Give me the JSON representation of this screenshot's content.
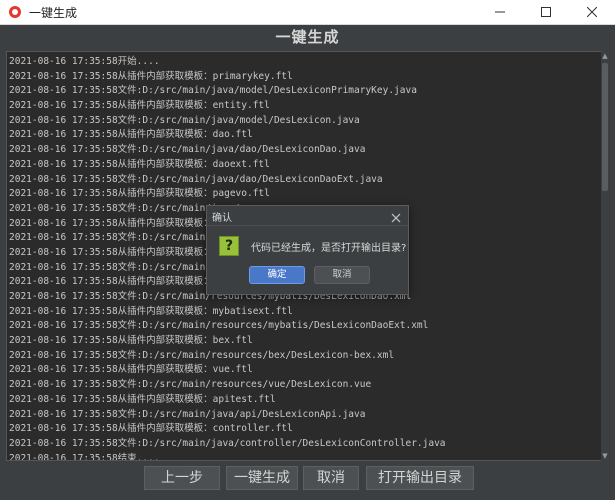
{
  "window": {
    "title": "一键生成",
    "icon": "app-logo-icon",
    "controls": [
      "minimize-icon",
      "maximize-icon",
      "close-icon"
    ]
  },
  "page": {
    "heading": "一键生成"
  },
  "log": {
    "lines": [
      "2021-08-16 17:35:58开始....",
      "2021-08-16 17:35:58从插件内部获取模板：primarykey.ftl",
      "2021-08-16 17:35:58文件:D:/src/main/java/model/DesLexiconPrimaryKey.java",
      "2021-08-16 17:35:58从插件内部获取模板：entity.ftl",
      "2021-08-16 17:35:58文件:D:/src/main/java/model/DesLexicon.java",
      "2021-08-16 17:35:58从插件内部获取模板：dao.ftl",
      "2021-08-16 17:35:58文件:D:/src/main/java/dao/DesLexiconDao.java",
      "2021-08-16 17:35:58从插件内部获取模板：daoext.ftl",
      "2021-08-16 17:35:58文件:D:/src/main/java/dao/DesLexiconDaoExt.java",
      "2021-08-16 17:35:58从插件内部获取模板：pagevo.ftl",
      "2021-08-16 17:35:58文件:D:/src/main/java/",
      "2021-08-16 17:35:58从插件内部获取模板：ser",
      "2021-08-16 17:35:58文件:D:/src/main/java/",
      "2021-08-16 17:35:58从插件内部获取模板：ser",
      "2021-08-16 17:35:58文件:D:/src/main/java/",
      "2021-08-16 17:35:58从插件内部获取模板：myb",
      "2021-08-16 17:35:58文件:D:/src/main/resources/mybatis/DesLexiconDao.xml",
      "2021-08-16 17:35:58从插件内部获取模板：mybatisext.ftl",
      "2021-08-16 17:35:58文件:D:/src/main/resources/mybatis/DesLexiconDaoExt.xml",
      "2021-08-16 17:35:58从插件内部获取模板：bex.ftl",
      "2021-08-16 17:35:58文件:D:/src/main/resources/bex/DesLexicon-bex.xml",
      "2021-08-16 17:35:58从插件内部获取模板：vue.ftl",
      "2021-08-16 17:35:58文件:D:/src/main/resources/vue/DesLexicon.vue",
      "2021-08-16 17:35:58从插件内部获取模板：apitest.ftl",
      "2021-08-16 17:35:58文件:D:/src/main/java/api/DesLexiconApi.java",
      "2021-08-16 17:35:58从插件内部获取模板：controller.ftl",
      "2021-08-16 17:35:58文件:D:/src/main/java/controller/DesLexiconController.java",
      "2021-08-16 17:35:58结束...."
    ]
  },
  "buttons": {
    "prev": "上一步",
    "generate": "一键生成",
    "cancel": "取消",
    "open_dir": "打开输出目录"
  },
  "dialog": {
    "title": "确认",
    "icon": "question-icon",
    "icon_glyph": "?",
    "message": "代码已经生成，是否打开输出目录?",
    "ok": "确定",
    "cancel": "取消"
  }
}
